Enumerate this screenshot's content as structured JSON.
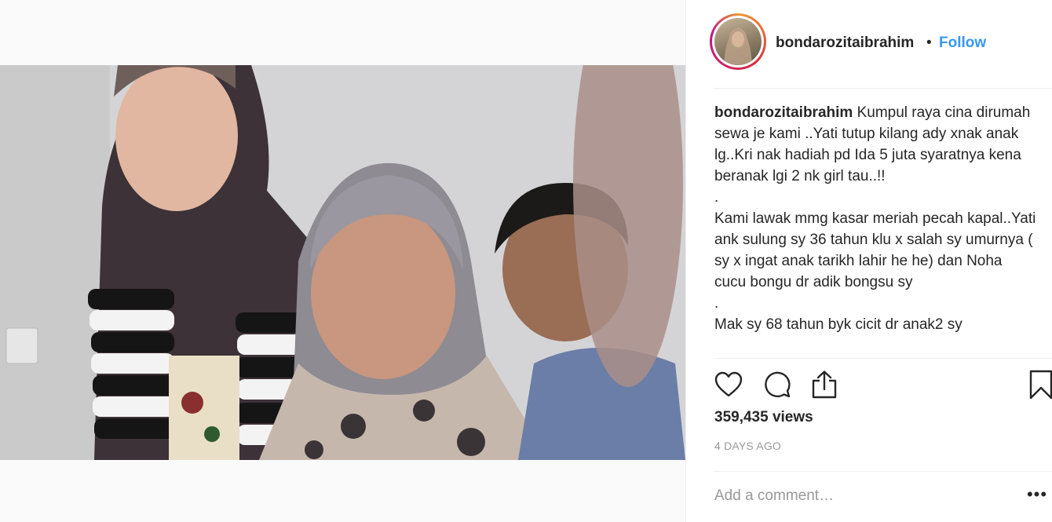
{
  "post": {
    "username": "bondarozitaibrahim",
    "separator": "•",
    "follow_label": "Follow",
    "caption": {
      "username": "bondarozitaibrahim",
      "lines": [
        "Kumpul raya cina dirumah sewa je kami ..Yati tutup kilang ady xnak anak lg..Kri nak hadiah pd Ida 5 juta syaratnya kena beranak lgi 2 nk girl tau..!!",
        ".",
        "Kami lawak mmg kasar meriah pecah kapal..Yati ank sulung sy 36 tahun klu x salah sy umurnya ( sy x ingat anak tarikh lahir he he) dan Noha cucu bongu dr adik bongsu sy",
        ".",
        "Mak sy 68 tahun byk cicit dr anak2 sy"
      ]
    },
    "views": "359,435 views",
    "time_ago": "4 DAYS AGO",
    "comment_placeholder": "Add a comment…",
    "more_label": "•••",
    "icons": {
      "like": "heart-icon",
      "comment": "comment-bubble-icon",
      "share": "share-icon",
      "save": "bookmark-icon",
      "more": "more-options-icon"
    }
  }
}
